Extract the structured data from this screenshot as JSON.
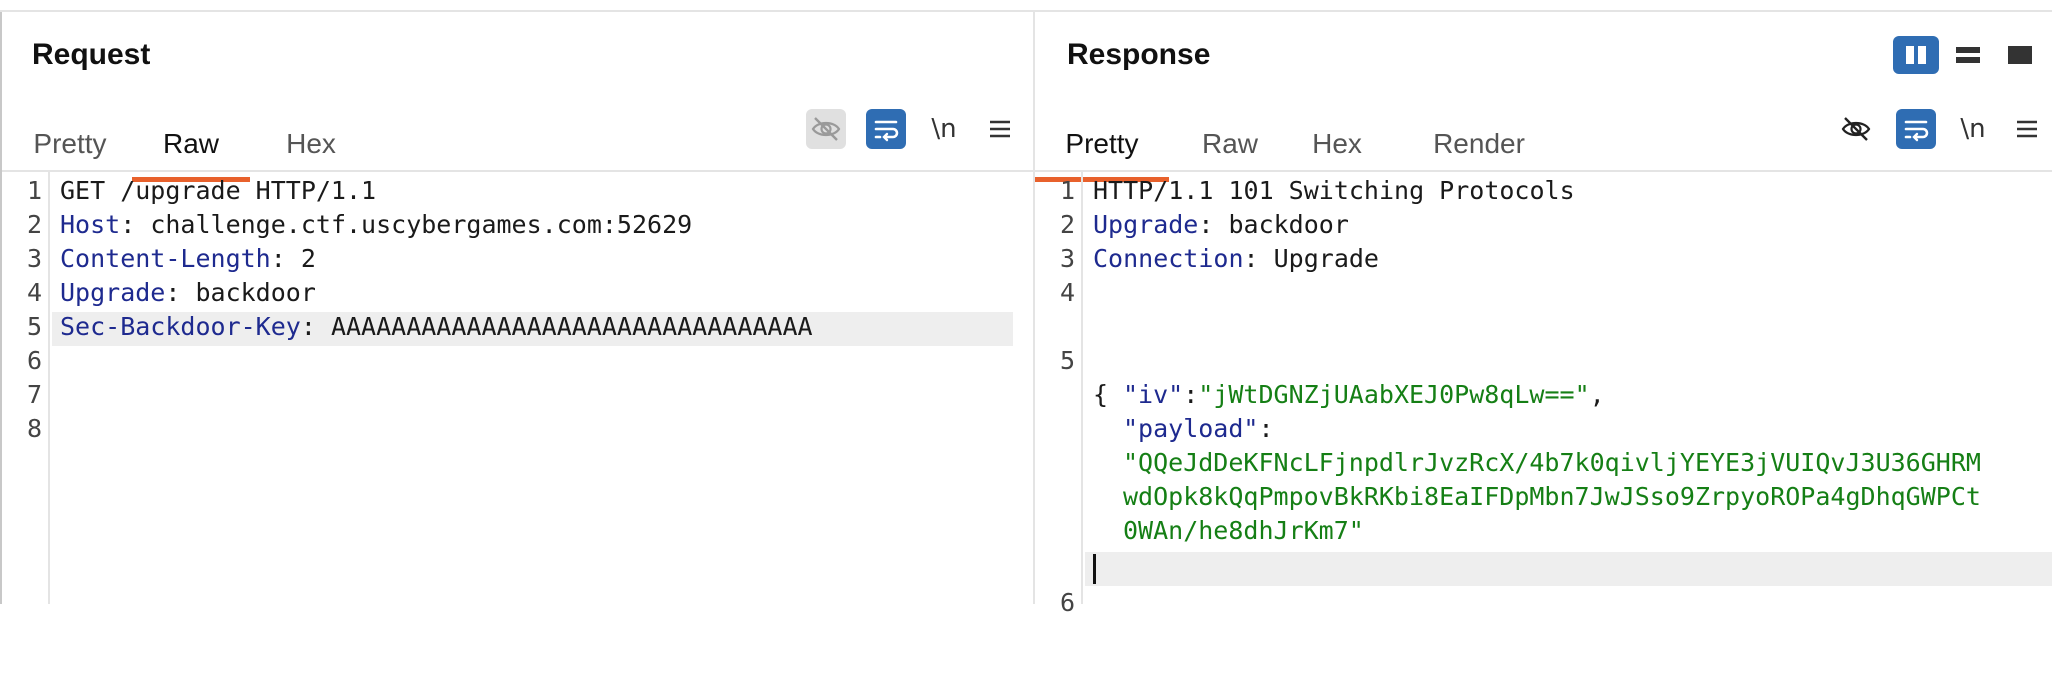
{
  "request": {
    "title": "Request",
    "tabs": [
      "Pretty",
      "Raw",
      "Hex"
    ],
    "active_tab": "Raw",
    "toolbar": {
      "newline_label": "\\n"
    },
    "lines": [
      {
        "n": "1",
        "key": "",
        "sep": "",
        "val": "GET /upgrade HTTP/1.1"
      },
      {
        "n": "2",
        "key": "Host",
        "sep": ": ",
        "val": "challenge.ctf.uscybergames.com:52629"
      },
      {
        "n": "3",
        "key": "Content-Length",
        "sep": ": ",
        "val": "2"
      },
      {
        "n": "4",
        "key": "Upgrade",
        "sep": ": ",
        "val": "backdoor"
      },
      {
        "n": "5",
        "key": "Sec-Backdoor-Key",
        "sep": ": ",
        "val": "AAAAAAAAAAAAAAAAAAAAAAAAAAAAAAAA"
      },
      {
        "n": "6",
        "key": "",
        "sep": "",
        "val": ""
      },
      {
        "n": "7",
        "key": "",
        "sep": "",
        "val": ""
      },
      {
        "n": "8",
        "key": "",
        "sep": "",
        "val": ""
      }
    ]
  },
  "response": {
    "title": "Response",
    "tabs": [
      "Pretty",
      "Raw",
      "Hex",
      "Render"
    ],
    "active_tab": "Pretty",
    "toolbar": {
      "newline_label": "\\n"
    },
    "lines": [
      {
        "n": "1",
        "key": "",
        "sep": "",
        "val": "HTTP/1.1 101 Switching Protocols"
      },
      {
        "n": "2",
        "key": "Upgrade",
        "sep": ": ",
        "val": "backdoor"
      },
      {
        "n": "3",
        "key": "Connection",
        "sep": ": ",
        "val": "Upgrade"
      },
      {
        "n": "4",
        "key": "",
        "sep": "",
        "val": ""
      }
    ],
    "json_line_number": "5",
    "json_open": "{",
    "json_close": "}",
    "iv_key": "\"iv\"",
    "iv_value": "\"jWtDGNZjUAabXEJ0Pw8qLw==\"",
    "payload_key": "\"payload\"",
    "payload_lines": [
      "\"QQeJdDeKFNcLFjnpdlrJvzRcX/4b7k0qivljYEYE3jVUIQvJ3U36GHRM",
      "wdOpk8kQqPmpovBkRKbi8EaIFDpMbn7JwJSso9ZrpyoROPa4gDhqGWPCt",
      "0WAn/he8dhJrKm7\""
    ],
    "last_line_number": "6"
  },
  "colors": {
    "accent_tab": "#e8612c",
    "toggle_blue": "#2f6db3",
    "header_key": "#1e2a8f",
    "json_string": "#157f15"
  }
}
